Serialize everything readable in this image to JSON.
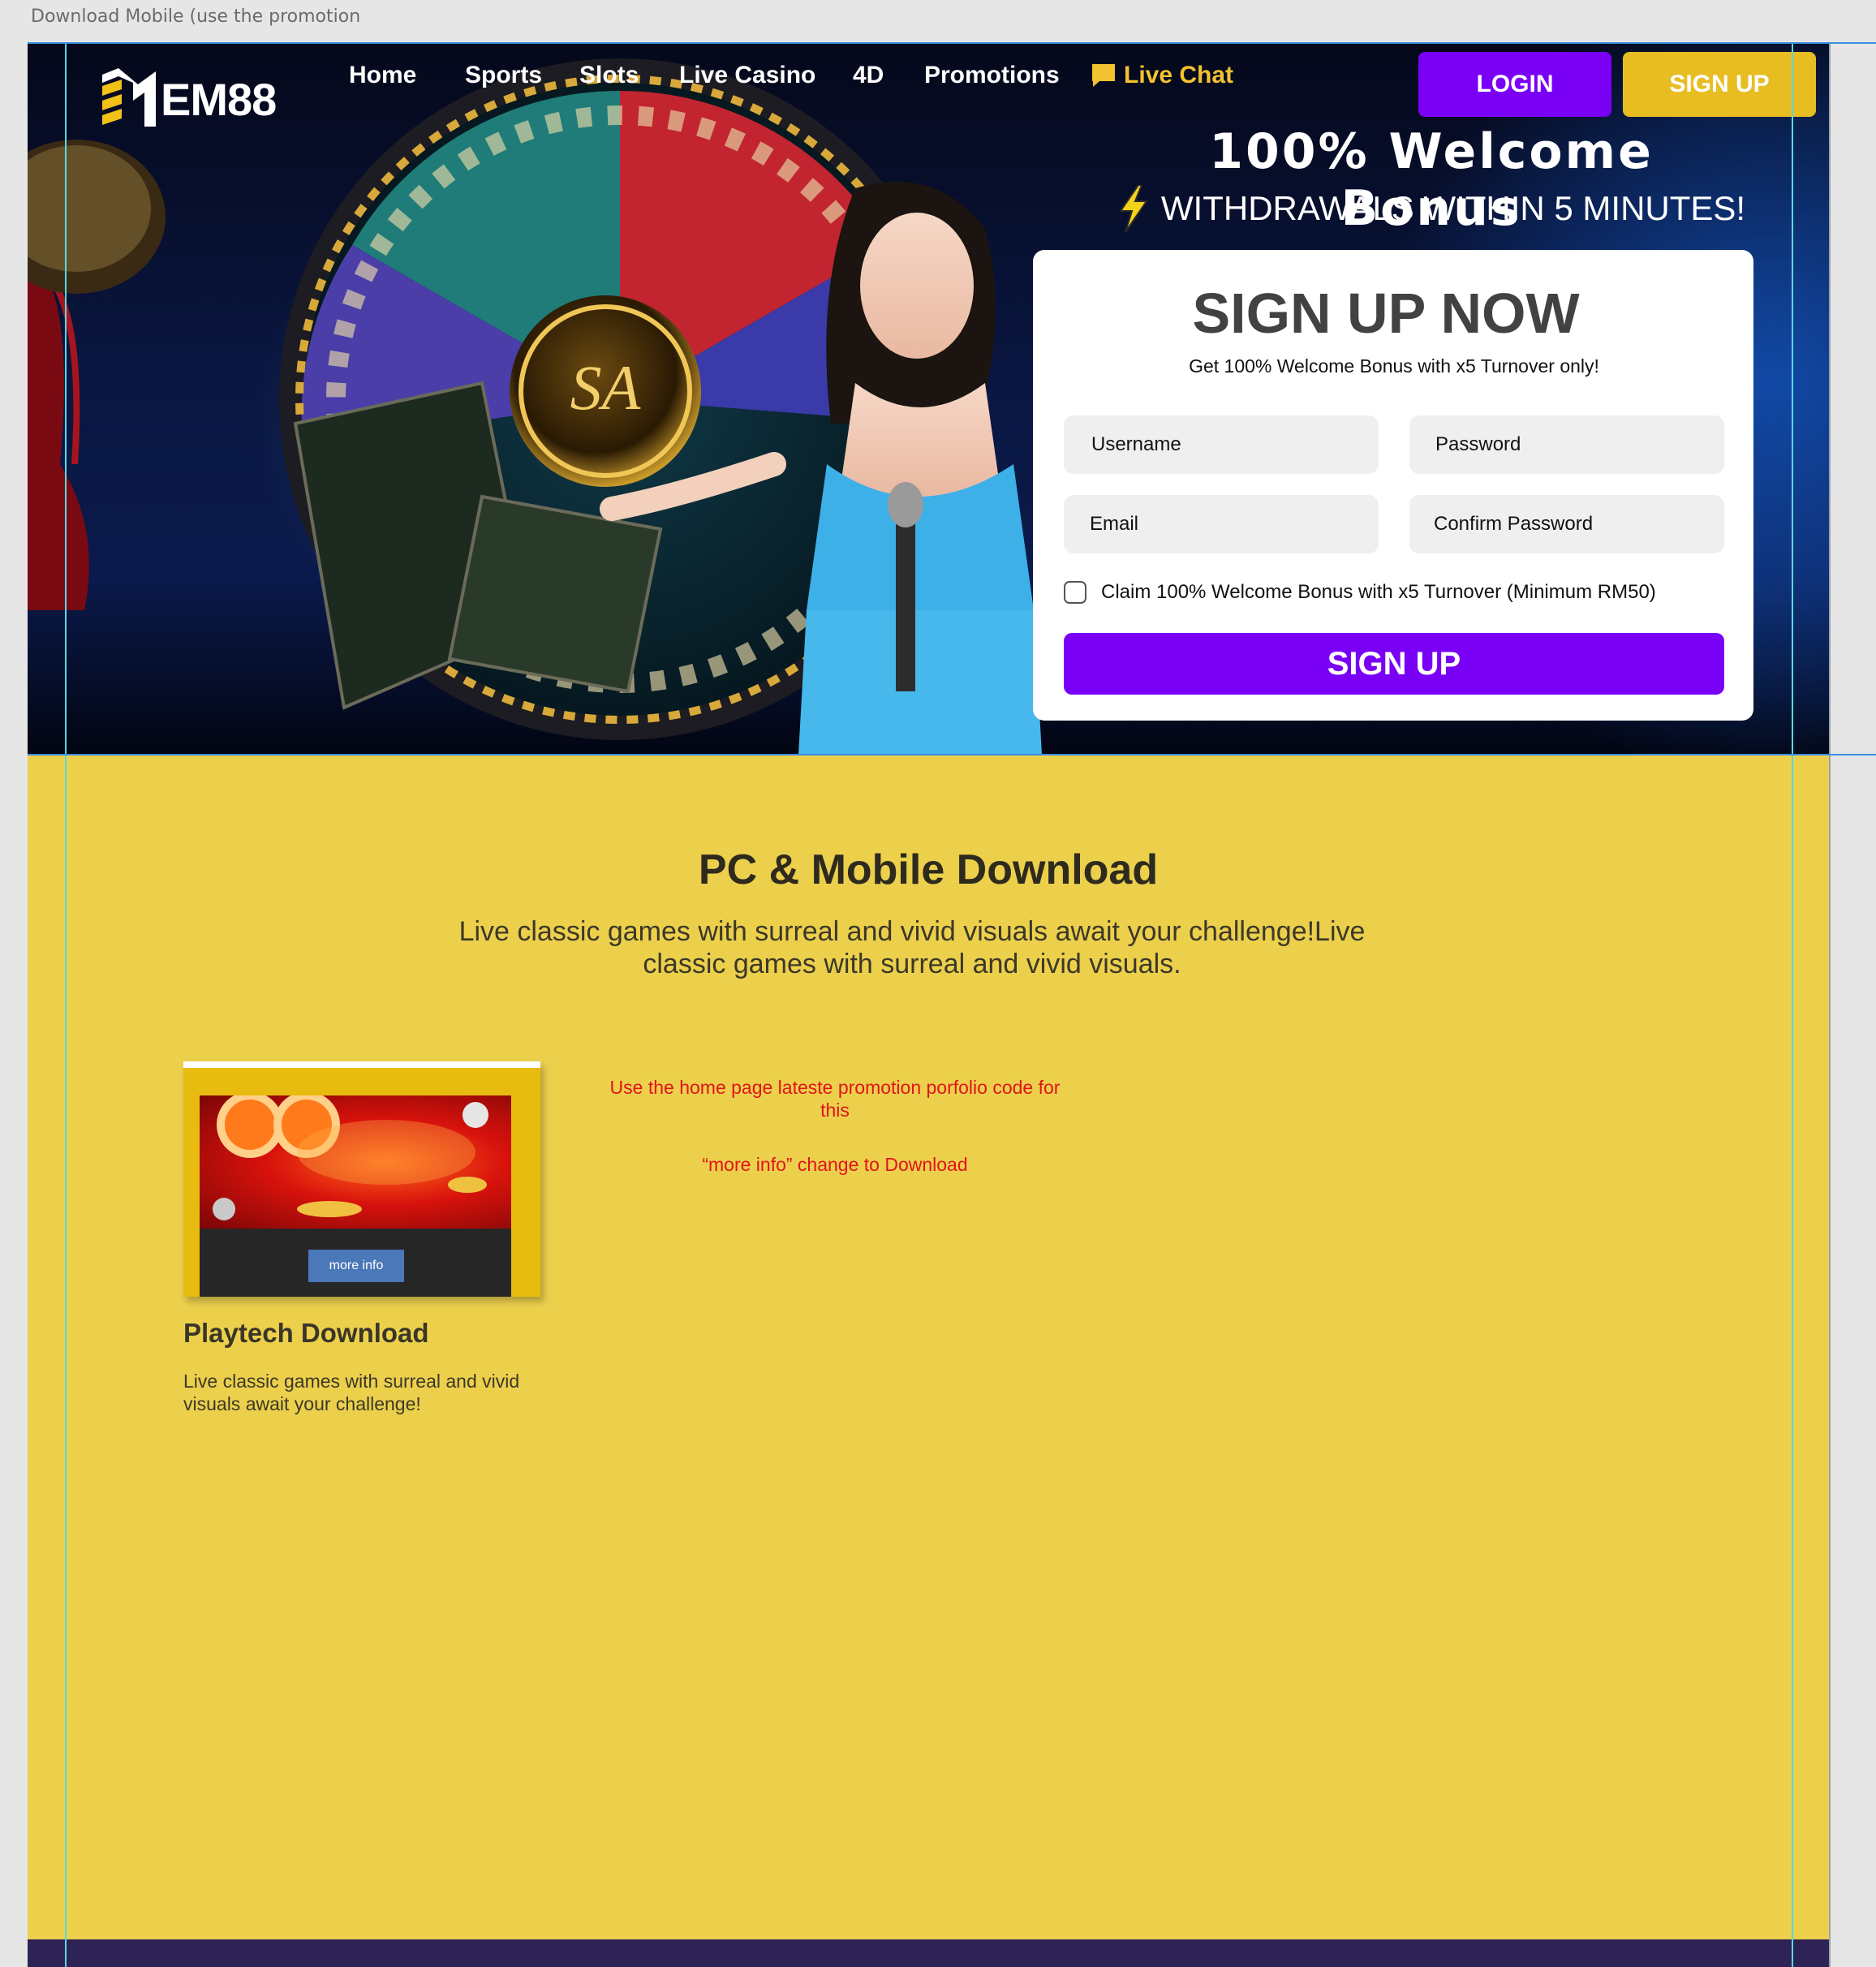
{
  "file_title": "Download Mobile (use the promotion",
  "brand": {
    "logo_text": "EM88"
  },
  "nav": {
    "items": [
      {
        "label": "Home"
      },
      {
        "label": "Sports"
      },
      {
        "label": "Slots"
      },
      {
        "label": "Live Casino"
      },
      {
        "label": "4D"
      },
      {
        "label": "Promotions"
      }
    ],
    "live_chat": "Live Chat"
  },
  "header": {
    "login": "LOGIN",
    "signup": "SIGN UP"
  },
  "hero": {
    "bonus_title": "100% Welcome Bonus",
    "withdraw_text": "WITHDRAWALS WITHIN 5 MINUTES!"
  },
  "signup_form": {
    "title": "SIGN UP NOW",
    "subtitle": "Get 100% Welcome Bonus with x5 Turnover only!",
    "username_placeholder": "Username",
    "password_placeholder": "Password",
    "email_placeholder": "Email",
    "confirm_password_placeholder": "Confirm Password",
    "bonus_checkbox_label": "Claim 100% Welcome Bonus with x5 Turnover (Minimum RM50)",
    "submit": "SIGN UP"
  },
  "download": {
    "title": "PC & Mobile Download",
    "description": "Live classic games with surreal and vivid visuals await your challenge!Live classic games with surreal and vivid visuals.",
    "cards": [
      {
        "button": "more info",
        "name": "Playtech Download",
        "description": "Live classic games with surreal and vivid visuals await your challenge!"
      }
    ],
    "note_line1": "Use the home page lateste promotion porfolio code for this",
    "note_line2": "“more info” change to Download"
  },
  "colors": {
    "section_yellow": "#ecd04c",
    "primary_purple": "#7a00f5",
    "signup_gold": "#e8bd22",
    "note_red": "#e0141a",
    "footer_navy": "#2e2355"
  },
  "icons": [
    "em88-logo-icon",
    "chat-bubble-icon",
    "lightning-bolt-icon"
  ]
}
